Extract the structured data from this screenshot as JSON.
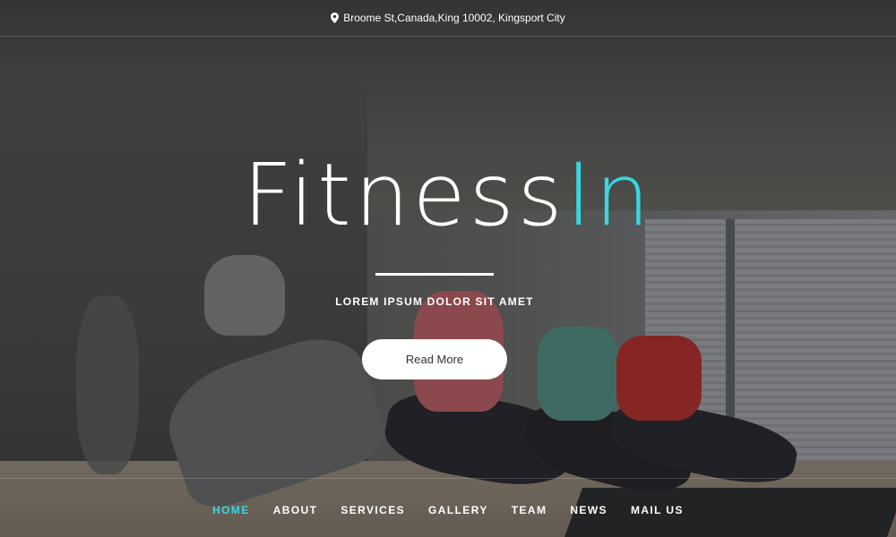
{
  "topbar": {
    "address": "Broome St,Canada,King 10002, Kingsport City",
    "icon": "map-pin-icon"
  },
  "hero": {
    "title_main": "Fitness",
    "title_accent": "In",
    "subtitle": "LOREM IPSUM DOLOR SIT AMET",
    "button_label": "Read More"
  },
  "nav": {
    "items": [
      {
        "label": "HOME"
      },
      {
        "label": "ABOUT"
      },
      {
        "label": "SERVICES"
      },
      {
        "label": "GALLERY"
      },
      {
        "label": "TEAM"
      },
      {
        "label": "NEWS"
      },
      {
        "label": "MAIL US"
      }
    ],
    "active": "HOME"
  },
  "colors": {
    "accent": "#37d6e0",
    "button_bg": "#ffffff",
    "text": "#ffffff"
  }
}
